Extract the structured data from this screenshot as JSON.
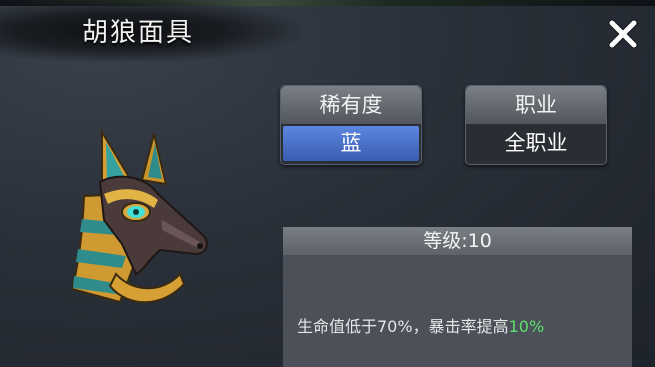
{
  "item": {
    "name": "胡狼面具"
  },
  "rarity": {
    "label": "稀有度",
    "value": "蓝",
    "color": "#4a74d0"
  },
  "job": {
    "label": "职业",
    "value": "全职业"
  },
  "level_text": "等级:10",
  "description": {
    "prefix": "生命值低于70%，暴击率提高",
    "highlight": "10%",
    "highlight_color": "#5fe06a"
  },
  "icons": {
    "close": "close-x-icon",
    "item": "jackal-mask-icon"
  }
}
